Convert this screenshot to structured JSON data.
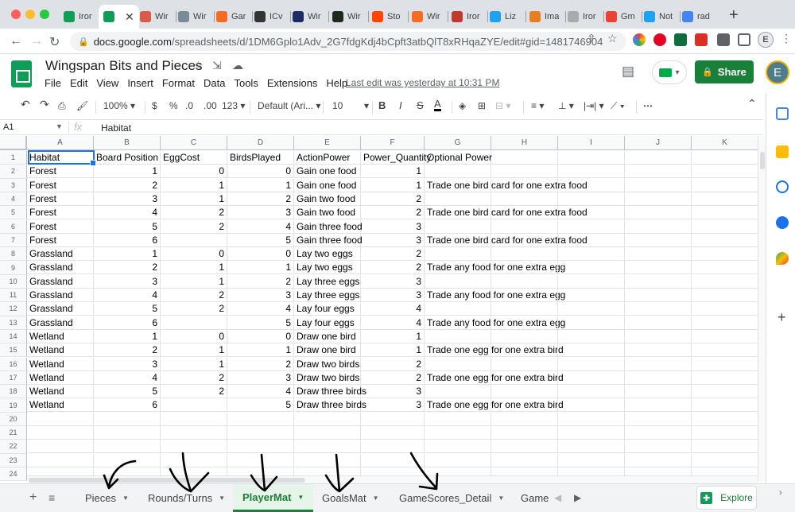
{
  "browser": {
    "tabs": [
      {
        "label": "Iror",
        "fav": "#0f9d58"
      },
      {
        "label": "",
        "fav": "#0f9d58",
        "active": true
      },
      {
        "label": "Wir",
        "fav": "#d85a49"
      },
      {
        "label": "Wir",
        "fav": "#7b8a97"
      },
      {
        "label": "Gar",
        "fav": "#f36c21"
      },
      {
        "label": "ICv",
        "fav": "#333333"
      },
      {
        "label": "Wir",
        "fav": "#1f2b66"
      },
      {
        "label": "Wir",
        "fav": "#1e2a1e"
      },
      {
        "label": "Sto",
        "fav": "#ff4500"
      },
      {
        "label": "Wir",
        "fav": "#f36c21"
      },
      {
        "label": "Iror",
        "fav": "#c0392b"
      },
      {
        "label": "Liz",
        "fav": "#1da1f2"
      },
      {
        "label": "Ima",
        "fav": "#e67e22"
      },
      {
        "label": "Iror",
        "fav": "#aaaaaa"
      },
      {
        "label": "Gm",
        "fav": "#ea4335"
      },
      {
        "label": "Not",
        "fav": "#1da1f2"
      },
      {
        "label": "rad",
        "fav": "#4285f4"
      }
    ],
    "close_label": "✕",
    "new_tab_label": "+",
    "url_host": "docs.google.com",
    "url_rest": "/spreadsheets/d/1DM6Gplo1Adv_2G7fdgKdj4bCpft3atbQlT8xRHqaZYE/edit#gid=1481746904",
    "profile_initial": "E"
  },
  "sheets": {
    "title": "Wingspan Bits and Pieces",
    "menu": [
      "File",
      "Edit",
      "View",
      "Insert",
      "Format",
      "Data",
      "Tools",
      "Extensions",
      "Help"
    ],
    "last_edit": "Last edit was yesterday at 10:31 PM",
    "share_label": "Share",
    "profile_initial": "E"
  },
  "toolbar": {
    "zoom": "100%",
    "currency": "$",
    "percent": "%",
    "dec_decrease": ".0",
    "dec_increase": ".00",
    "number_format": "123",
    "font": "Default (Ari...",
    "font_size": "10",
    "bold": "B",
    "italic": "I",
    "strike": "S",
    "text_color": "A",
    "more": "⋯"
  },
  "formula_bar": {
    "cell_ref": "A1",
    "fx": "fx",
    "value": "Habitat"
  },
  "grid": {
    "columns": [
      "A",
      "B",
      "C",
      "D",
      "E",
      "F",
      "G",
      "H",
      "I",
      "J",
      "K"
    ],
    "header": [
      "Habitat",
      "Board Position",
      "EggCost",
      "BirdsPlayed",
      "ActionPower",
      "Power_Quantity",
      "Optional Power"
    ],
    "rows": [
      [
        "Forest",
        "1",
        "0",
        "0",
        "Gain one food",
        "1",
        ""
      ],
      [
        "Forest",
        "2",
        "1",
        "1",
        "Gain one food",
        "1",
        "Trade one bird card for one extra food"
      ],
      [
        "Forest",
        "3",
        "1",
        "2",
        "Gain two food",
        "2",
        ""
      ],
      [
        "Forest",
        "4",
        "2",
        "3",
        "Gain two food",
        "2",
        "Trade one bird card for one extra food"
      ],
      [
        "Forest",
        "5",
        "2",
        "4",
        "Gain three food",
        "3",
        ""
      ],
      [
        "Forest",
        "6",
        "",
        "5",
        "Gain three food",
        "3",
        "Trade one bird card for one extra food"
      ],
      [
        "Grassland",
        "1",
        "0",
        "0",
        "Lay two eggs",
        "2",
        ""
      ],
      [
        "Grassland",
        "2",
        "1",
        "1",
        "Lay two eggs",
        "2",
        "Trade any food for one extra egg"
      ],
      [
        "Grassland",
        "3",
        "1",
        "2",
        "Lay three eggs",
        "3",
        ""
      ],
      [
        "Grassland",
        "4",
        "2",
        "3",
        "Lay three eggs",
        "3",
        "Trade any food for one extra egg"
      ],
      [
        "Grassland",
        "5",
        "2",
        "4",
        "Lay four eggs",
        "4",
        ""
      ],
      [
        "Grassland",
        "6",
        "",
        "5",
        "Lay four eggs",
        "4",
        "Trade any food for one extra egg"
      ],
      [
        "Wetland",
        "1",
        "0",
        "0",
        "Draw one bird",
        "1",
        ""
      ],
      [
        "Wetland",
        "2",
        "1",
        "1",
        "Draw one bird",
        "1",
        "Trade one egg for one extra bird"
      ],
      [
        "Wetland",
        "3",
        "1",
        "2",
        "Draw two birds",
        "2",
        ""
      ],
      [
        "Wetland",
        "4",
        "2",
        "3",
        "Draw two birds",
        "2",
        "Trade one egg for one extra bird"
      ],
      [
        "Wetland",
        "5",
        "2",
        "4",
        "Draw three birds",
        "3",
        ""
      ],
      [
        "Wetland",
        "6",
        "",
        "5",
        "Draw three birds",
        "3",
        "Trade one egg for one extra bird"
      ],
      [
        "",
        "",
        "",
        "",
        "",
        "",
        ""
      ],
      [
        "",
        "",
        "",
        "",
        "",
        "",
        ""
      ],
      [
        "",
        "",
        "",
        "",
        "",
        "",
        ""
      ],
      [
        "",
        "",
        "",
        "",
        "",
        "",
        ""
      ],
      [
        "",
        "",
        "",
        "",
        "",
        "",
        ""
      ]
    ],
    "numeric_columns": [
      1,
      2,
      3,
      5
    ]
  },
  "sheet_tabs": {
    "add_label": "+",
    "menu_label": "≡",
    "tabs": [
      {
        "label": "Pieces",
        "active": false
      },
      {
        "label": "Rounds/Turns",
        "active": false
      },
      {
        "label": "PlayerMat",
        "active": true
      },
      {
        "label": "GoalsMat",
        "active": false
      },
      {
        "label": "GameScores_Detail",
        "active": false
      },
      {
        "label": "Game",
        "active": false
      }
    ],
    "explore_label": "Explore"
  },
  "colors": {
    "accent_green": "#188038",
    "selection_blue": "#1a73e8",
    "header_bg": "#f8f9fa"
  },
  "side_panel_icons": [
    "calendar-icon",
    "keep-icon",
    "tasks-icon",
    "contacts-icon",
    "maps-icon"
  ]
}
